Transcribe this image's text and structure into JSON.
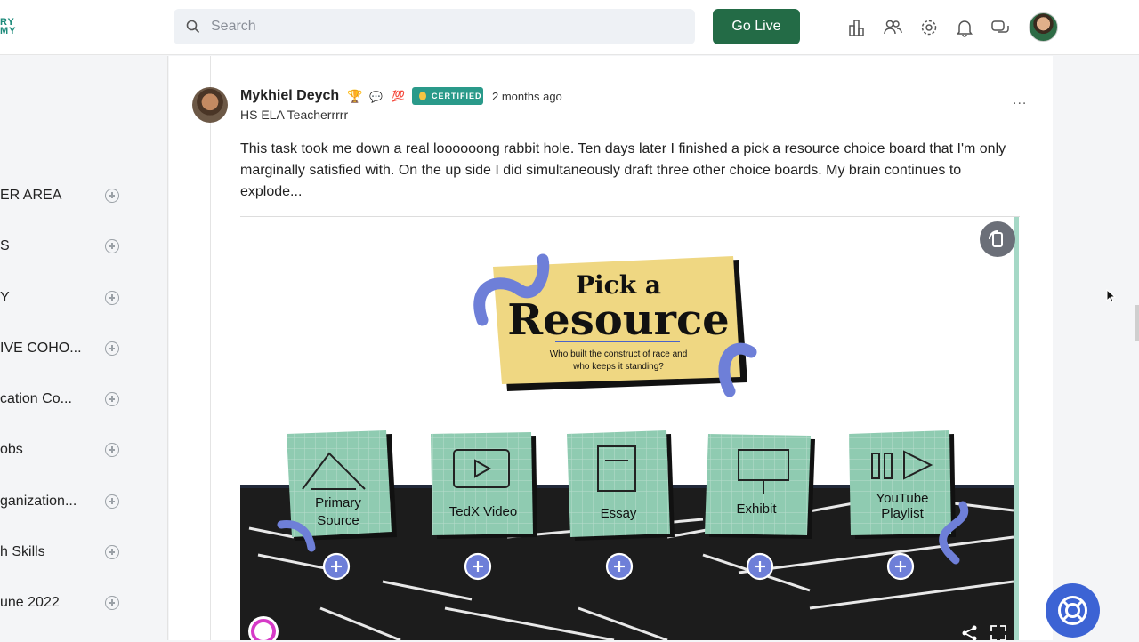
{
  "header": {
    "logo_line1": "RY",
    "logo_line2": "MY",
    "search_placeholder": "Search",
    "go_live_label": "Go Live"
  },
  "sidebar": {
    "items": [
      {
        "label": "ER AREA"
      },
      {
        "label": "S"
      },
      {
        "label": "Y"
      },
      {
        "label": "IVE COHO..."
      },
      {
        "label": "cation Co..."
      },
      {
        "label": "obs"
      },
      {
        "label": "ganization..."
      },
      {
        "label": "h Skills"
      },
      {
        "label": "une 2022"
      }
    ]
  },
  "post": {
    "author": "Mykhiel Deych",
    "badges": [
      "🏆",
      "💬",
      "💯"
    ],
    "certified_label": "CERTIFIED",
    "time_ago": "2 months ago",
    "role": "HS ELA Teacherrrrr",
    "body": "This task took me down a real loooooong rabbit hole. Ten days later I finished a pick a resource choice board that I'm only marginally satisfied with. On the up side I did simultaneously draft three other choice boards. My brain continues to explode...",
    "more_label": "..."
  },
  "embed": {
    "title_line1": "Pick a",
    "title_line2": "Resource",
    "subtitle_line1": "Who built the construct of race and",
    "subtitle_line2": "who keeps it standing?",
    "cards": [
      {
        "label_line1": "Primary",
        "label_line2": "Source"
      },
      {
        "label_line1": "TedX Video",
        "label_line2": ""
      },
      {
        "label_line1": "Essay",
        "label_line2": ""
      },
      {
        "label_line1": "Exhibit",
        "label_line2": ""
      },
      {
        "label_line1": "YouTube",
        "label_line2": "Playlist"
      }
    ]
  },
  "colors": {
    "go_live": "#236b46",
    "certified": "#2a9a8a",
    "sticky_yellow": "#efd782",
    "card_green": "#8fcbb1",
    "squiggle": "#6e7fd8",
    "help_button": "#3c63d4"
  }
}
